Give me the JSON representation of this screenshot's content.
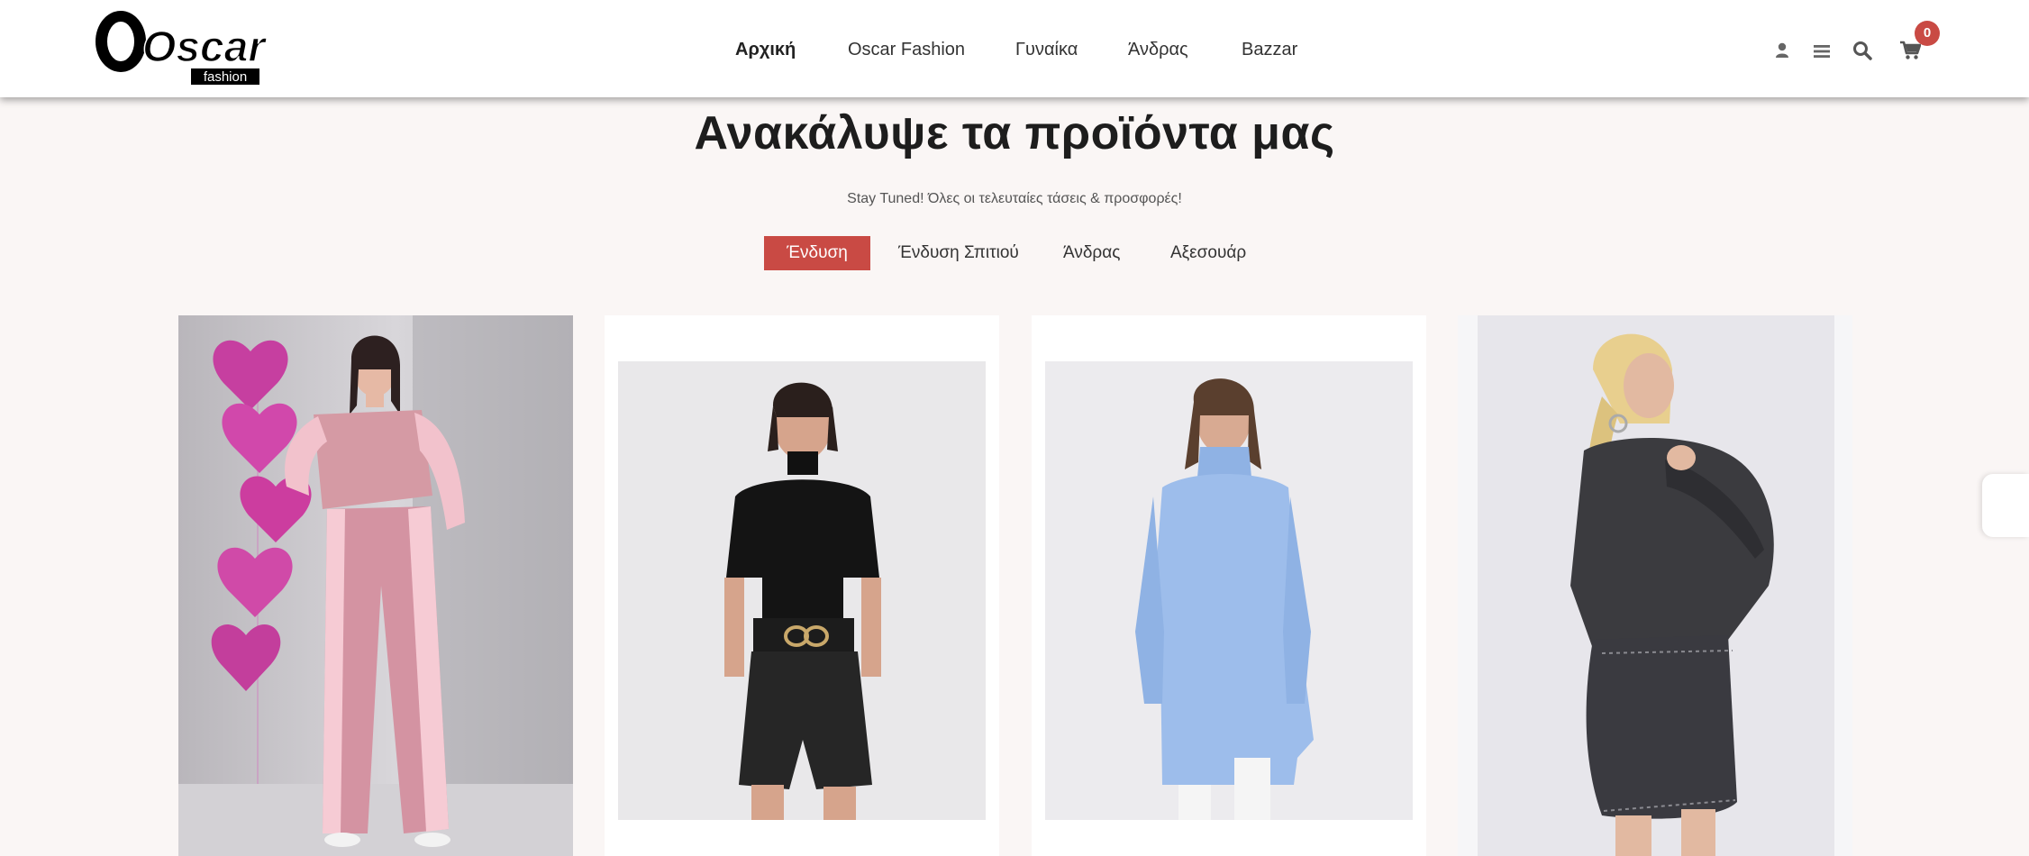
{
  "brand": {
    "logo_text": "Oscar",
    "logo_sub": "fashion"
  },
  "nav": {
    "items": [
      {
        "label": "Αρχική",
        "active": true
      },
      {
        "label": "Oscar Fashion"
      },
      {
        "label": "Γυναίκα"
      },
      {
        "label": "Άνδρας"
      },
      {
        "label": "Bazzar"
      }
    ]
  },
  "header_icons": {
    "user": "user-icon",
    "menu": "menu-icon",
    "search": "search-icon",
    "cart": "cart-icon",
    "cart_count": "0"
  },
  "hero": {
    "title": "Ανακάλυψε τα προϊόντα μας",
    "subtitle": "Stay Tuned! Όλες οι τελευταίες τάσεις & προσφορές!"
  },
  "tabs": [
    {
      "label": "Ένδυση",
      "active": true
    },
    {
      "label": "Ένδυση Σπιτιού"
    },
    {
      "label": "Άνδρας"
    },
    {
      "label": "Αξεσουάρ"
    }
  ],
  "colors": {
    "accent": "#c94a44",
    "background": "#faf6f5",
    "header": "#ffffff"
  }
}
